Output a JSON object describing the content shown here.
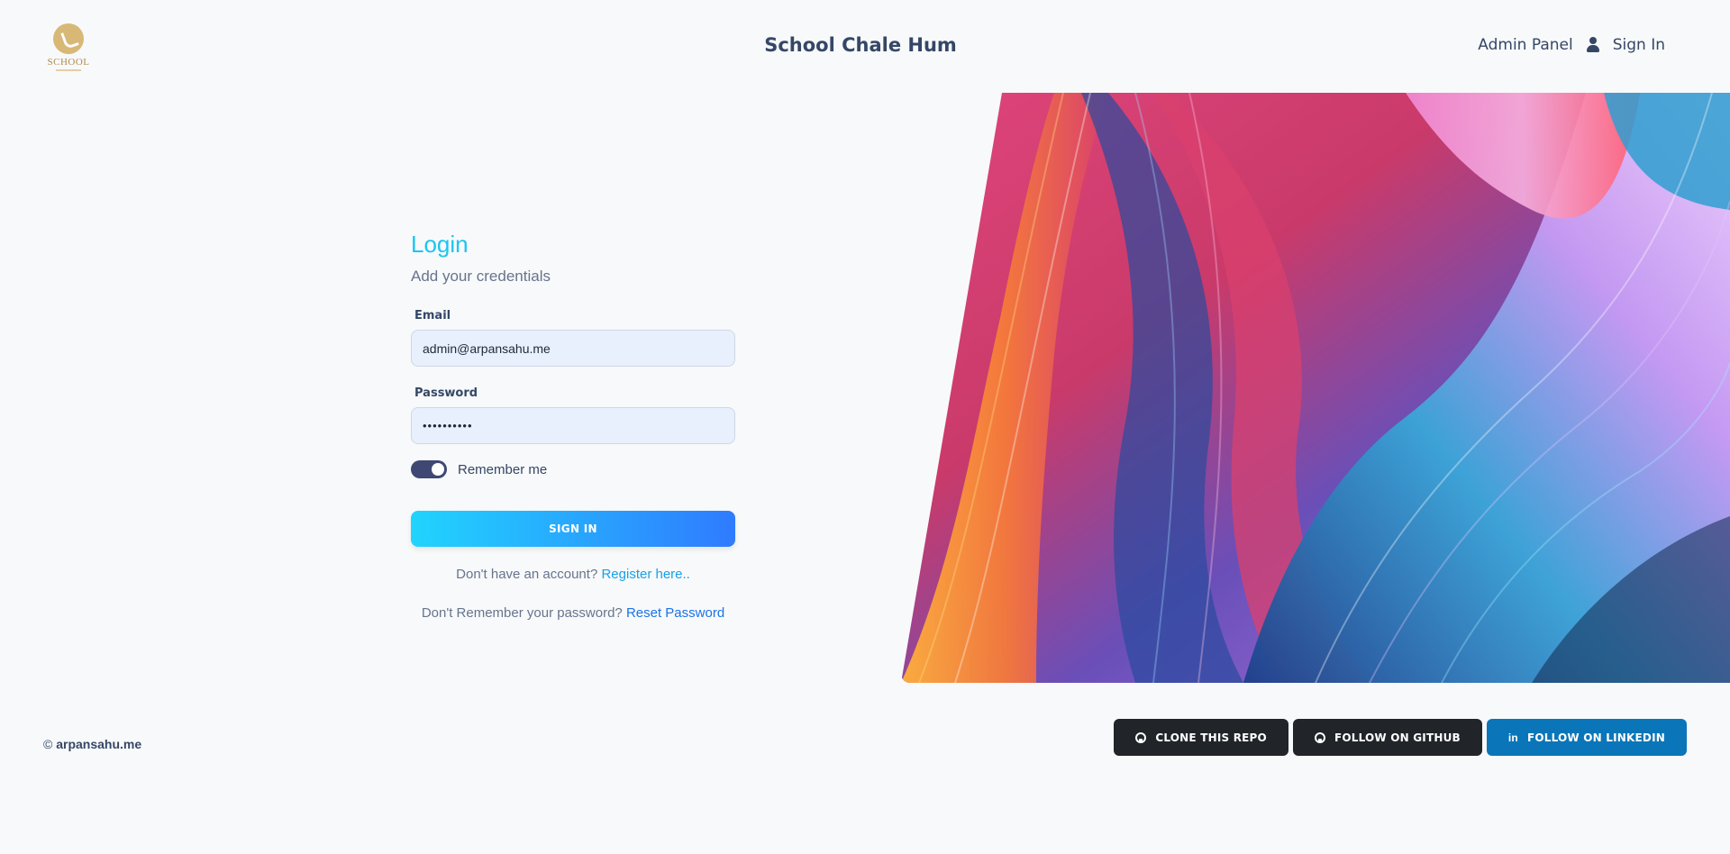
{
  "header": {
    "logo_text": "SCHOOL",
    "brand": "School Chale Hum",
    "admin_panel": "Admin Panel",
    "sign_in": "Sign In"
  },
  "login": {
    "title": "Login",
    "subtitle": "Add your credentials",
    "email_label": "Email",
    "email_value": "admin@arpansahu.me",
    "password_label": "Password",
    "password_value": "••••••••••",
    "remember_label": "Remember me",
    "remember_checked": true,
    "submit_label": "SIGN IN",
    "register_prompt": "Don't have an account?",
    "register_link": "Register here..",
    "reset_prompt": "Don't Remember your password?",
    "reset_link": "Reset Password"
  },
  "footer": {
    "copyright_symbol": "©",
    "copyright_name": "arpansahu.me",
    "buttons": [
      {
        "label": "CLONE THIS REPO",
        "icon": "github-icon"
      },
      {
        "label": "FOLLOW ON GITHUB",
        "icon": "github-icon"
      },
      {
        "label": "FOLLOW ON LINKEDIN",
        "icon": "linkedin-icon"
      }
    ]
  },
  "colors": {
    "accent": "#1cc5ef",
    "link": "#17a2e6",
    "button_gradient_start": "#21d4fd",
    "button_gradient_end": "#2f7bff",
    "linkedin": "#0a76b9",
    "dark_button": "#212529"
  }
}
